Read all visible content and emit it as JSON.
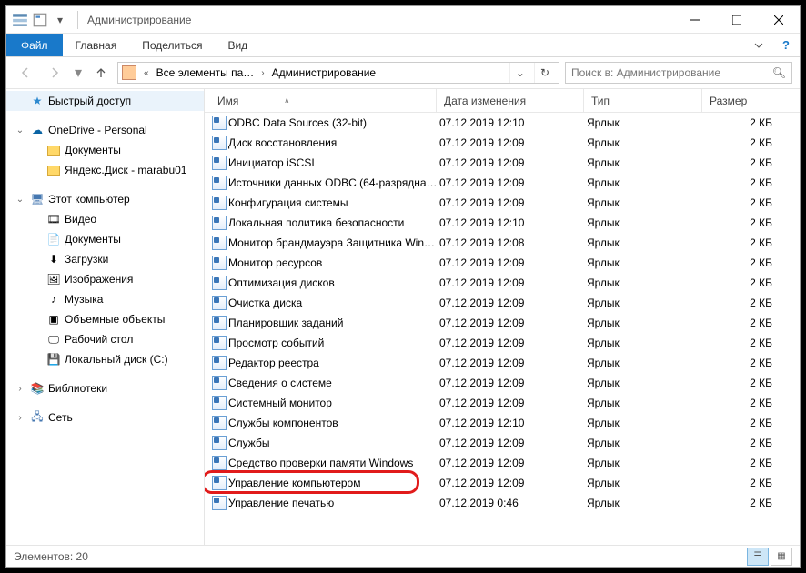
{
  "window": {
    "title": "Администрирование"
  },
  "menus": {
    "file": "Файл",
    "home": "Главная",
    "share": "Поделиться",
    "view": "Вид"
  },
  "address": {
    "crumb1": "Все элементы па…",
    "crumb2": "Администрирование"
  },
  "search": {
    "placeholder": "Поиск в: Администрирование"
  },
  "columns": {
    "name": "Имя",
    "date": "Дата изменения",
    "type": "Тип",
    "size": "Размер"
  },
  "nav": {
    "quick": "Быстрый доступ",
    "onedrive": "OneDrive - Personal",
    "documents": "Документы",
    "yandex": "Яндекс.Диск - marabu01",
    "thispc": "Этот компьютер",
    "video": "Видео",
    "documents2": "Документы",
    "downloads": "Загрузки",
    "pictures": "Изображения",
    "music": "Музыка",
    "objects3d": "Объемные объекты",
    "desktop": "Рабочий стол",
    "cdrive": "Локальный диск (C:)",
    "libraries": "Библиотеки",
    "network": "Сеть"
  },
  "files": [
    {
      "name": "ODBC Data Sources (32-bit)",
      "date": "07.12.2019 12:10",
      "type": "Ярлык",
      "size": "2 КБ"
    },
    {
      "name": "Диск восстановления",
      "date": "07.12.2019 12:09",
      "type": "Ярлык",
      "size": "2 КБ"
    },
    {
      "name": "Инициатор iSCSI",
      "date": "07.12.2019 12:09",
      "type": "Ярлык",
      "size": "2 КБ"
    },
    {
      "name": "Источники данных ODBC (64-разрядна…",
      "date": "07.12.2019 12:09",
      "type": "Ярлык",
      "size": "2 КБ"
    },
    {
      "name": "Конфигурация системы",
      "date": "07.12.2019 12:09",
      "type": "Ярлык",
      "size": "2 КБ"
    },
    {
      "name": "Локальная политика безопасности",
      "date": "07.12.2019 12:10",
      "type": "Ярлык",
      "size": "2 КБ"
    },
    {
      "name": "Монитор брандмауэра Защитника Win…",
      "date": "07.12.2019 12:08",
      "type": "Ярлык",
      "size": "2 КБ"
    },
    {
      "name": "Монитор ресурсов",
      "date": "07.12.2019 12:09",
      "type": "Ярлык",
      "size": "2 КБ"
    },
    {
      "name": "Оптимизация дисков",
      "date": "07.12.2019 12:09",
      "type": "Ярлык",
      "size": "2 КБ"
    },
    {
      "name": "Очистка диска",
      "date": "07.12.2019 12:09",
      "type": "Ярлык",
      "size": "2 КБ"
    },
    {
      "name": "Планировщик заданий",
      "date": "07.12.2019 12:09",
      "type": "Ярлык",
      "size": "2 КБ"
    },
    {
      "name": "Просмотр событий",
      "date": "07.12.2019 12:09",
      "type": "Ярлык",
      "size": "2 КБ"
    },
    {
      "name": "Редактор реестра",
      "date": "07.12.2019 12:09",
      "type": "Ярлык",
      "size": "2 КБ"
    },
    {
      "name": "Сведения о системе",
      "date": "07.12.2019 12:09",
      "type": "Ярлык",
      "size": "2 КБ"
    },
    {
      "name": "Системный монитор",
      "date": "07.12.2019 12:09",
      "type": "Ярлык",
      "size": "2 КБ"
    },
    {
      "name": "Службы компонентов",
      "date": "07.12.2019 12:10",
      "type": "Ярлык",
      "size": "2 КБ"
    },
    {
      "name": "Службы",
      "date": "07.12.2019 12:09",
      "type": "Ярлык",
      "size": "2 КБ"
    },
    {
      "name": "Средство проверки памяти Windows",
      "date": "07.12.2019 12:09",
      "type": "Ярлык",
      "size": "2 КБ"
    },
    {
      "name": "Управление компьютером",
      "date": "07.12.2019 12:09",
      "type": "Ярлык",
      "size": "2 КБ"
    },
    {
      "name": "Управление печатью",
      "date": "07.12.2019 0:46",
      "type": "Ярлык",
      "size": "2 КБ"
    }
  ],
  "highlight_index": 18,
  "status": {
    "count": "Элементов: 20"
  }
}
